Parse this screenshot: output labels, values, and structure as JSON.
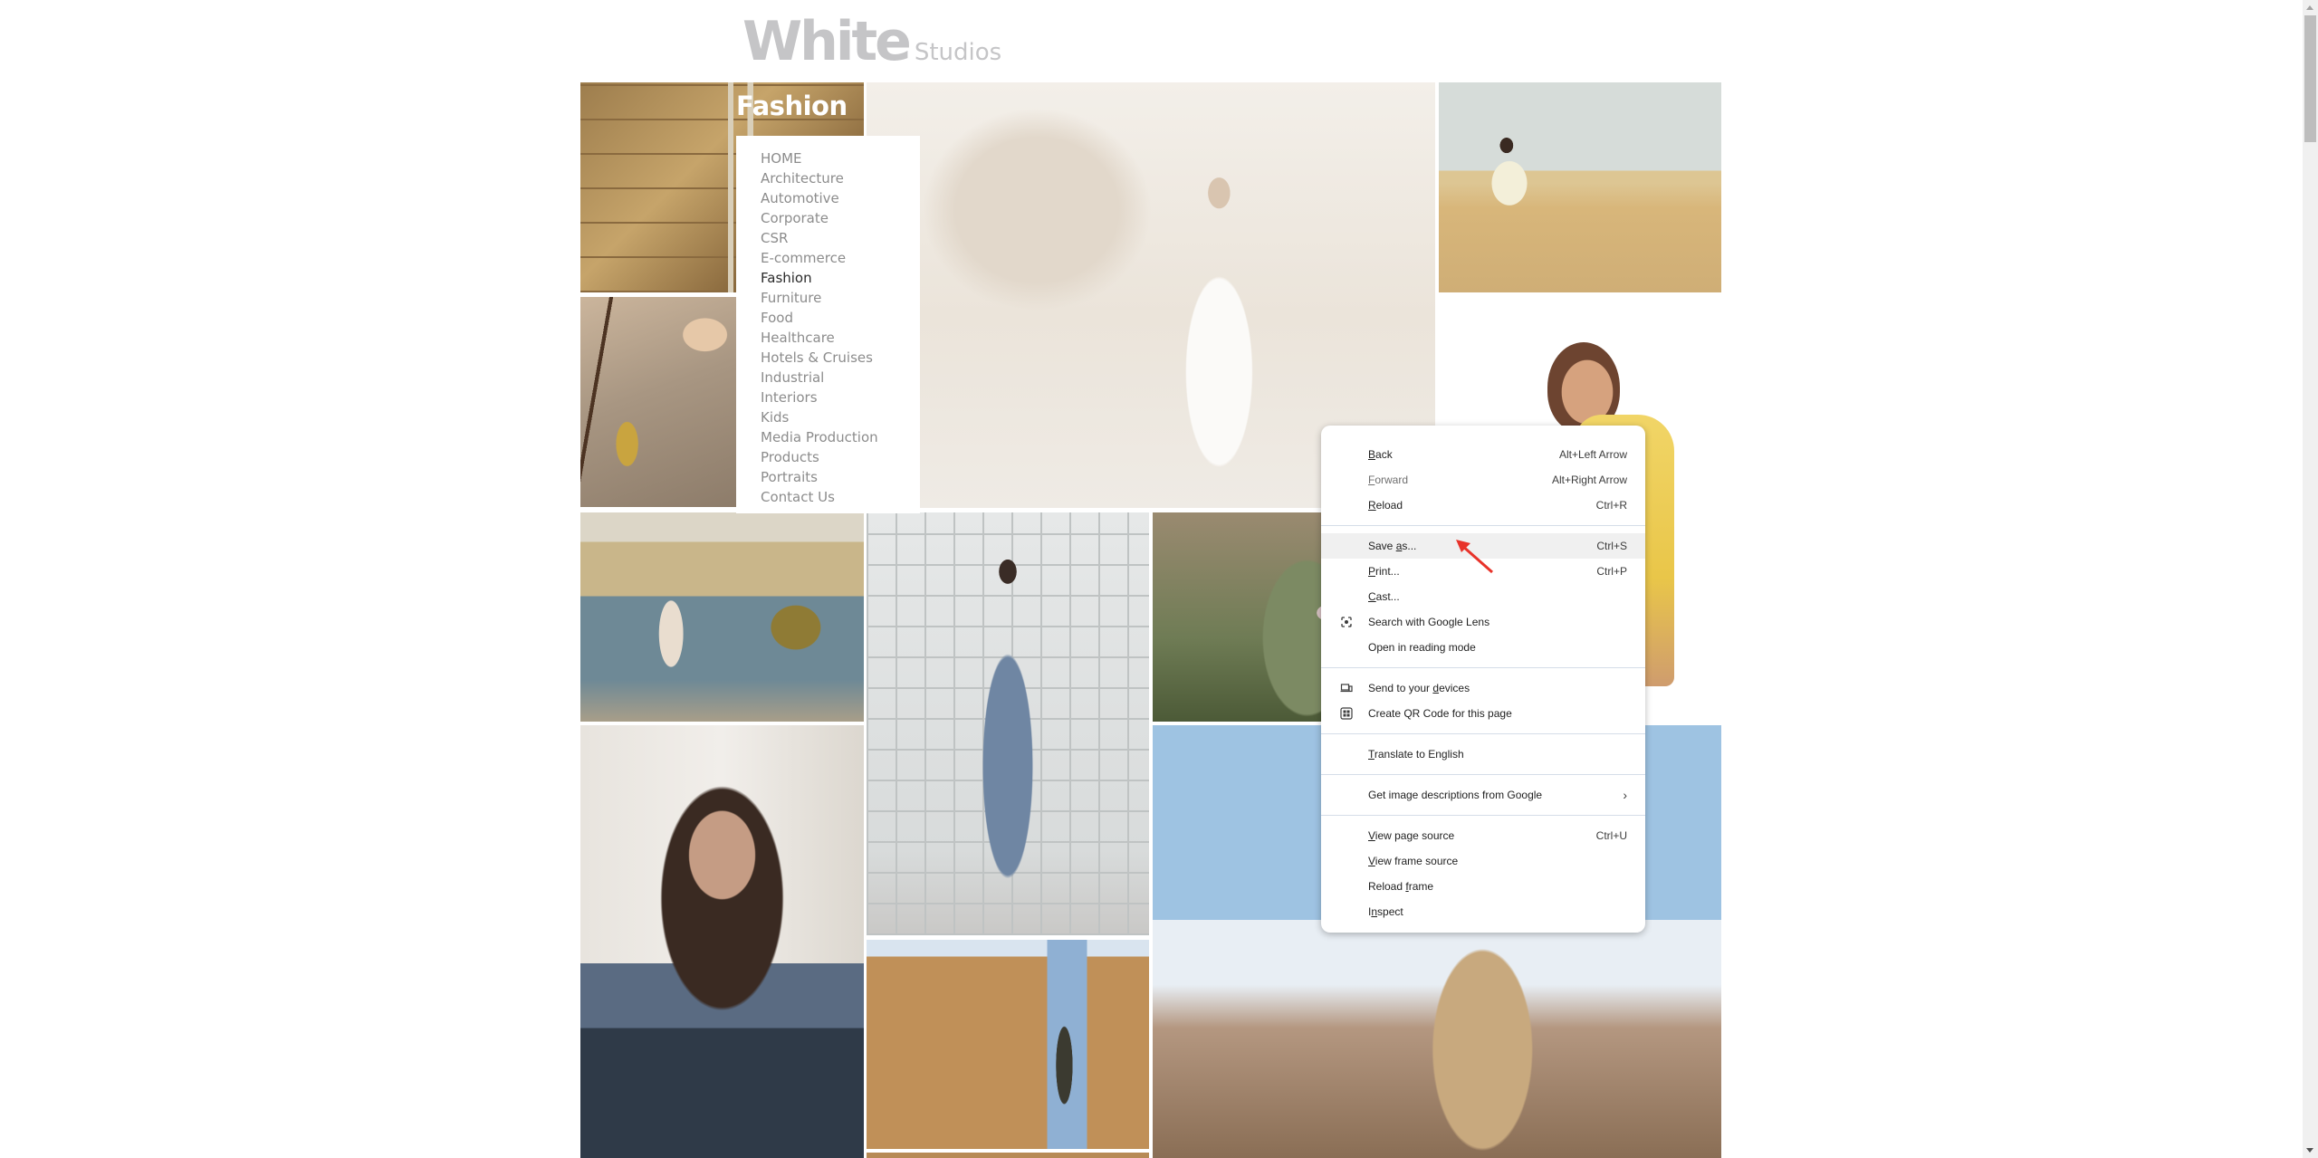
{
  "logo": {
    "main": "White",
    "sub": "Studios"
  },
  "page": {
    "heading": "Fashion"
  },
  "nav": {
    "items": [
      {
        "label": "HOME",
        "active": false
      },
      {
        "label": "Architecture",
        "active": false
      },
      {
        "label": "Automotive",
        "active": false
      },
      {
        "label": "Corporate",
        "active": false
      },
      {
        "label": "CSR",
        "active": false
      },
      {
        "label": "E-commerce",
        "active": false
      },
      {
        "label": "Fashion",
        "active": true
      },
      {
        "label": "Furniture",
        "active": false
      },
      {
        "label": "Food",
        "active": false
      },
      {
        "label": "Healthcare",
        "active": false
      },
      {
        "label": "Hotels & Cruises",
        "active": false
      },
      {
        "label": "Industrial",
        "active": false
      },
      {
        "label": "Interiors",
        "active": false
      },
      {
        "label": "Kids",
        "active": false
      },
      {
        "label": "Media Production",
        "active": false
      },
      {
        "label": "Products",
        "active": false
      },
      {
        "label": "Portraits",
        "active": false
      },
      {
        "label": "Contact Us",
        "active": false
      }
    ]
  },
  "gallery": {
    "tiles": [
      {
        "name": "woman-stone-wall-ladder"
      },
      {
        "name": "gold-necklace-closeup"
      },
      {
        "name": "woman-desert-cliff-faded"
      },
      {
        "name": "woman-sitting-desert-dune"
      },
      {
        "name": "woman-yellow-top"
      },
      {
        "name": "man-beach-lake"
      },
      {
        "name": "woman-blue-outfit-glass-wall"
      },
      {
        "name": "woman-green-embroidered-kimono"
      },
      {
        "name": "woman-portrait-lace-top"
      },
      {
        "name": "man-mud-wall-doorway"
      },
      {
        "name": "man-beige-jacket-sky"
      }
    ]
  },
  "context_menu": {
    "groups": [
      [
        {
          "pre": "",
          "u": "B",
          "post": "ack",
          "shortcut": "Alt+Left Arrow",
          "disabled": false,
          "icon": null
        },
        {
          "pre": "",
          "u": "F",
          "post": "orward",
          "shortcut": "Alt+Right Arrow",
          "disabled": true,
          "icon": null
        },
        {
          "pre": "",
          "u": "R",
          "post": "eload",
          "shortcut": "Ctrl+R",
          "disabled": false,
          "icon": null
        }
      ],
      [
        {
          "pre": "Save ",
          "u": "a",
          "post": "s...",
          "shortcut": "Ctrl+S",
          "disabled": false,
          "highlighted": true,
          "icon": null
        },
        {
          "pre": "",
          "u": "P",
          "post": "rint...",
          "shortcut": "Ctrl+P",
          "disabled": false,
          "icon": null
        },
        {
          "pre": "",
          "u": "C",
          "post": "ast...",
          "shortcut": "",
          "disabled": false,
          "icon": null
        },
        {
          "pre": "Search with Google Lens",
          "u": "",
          "post": "",
          "shortcut": "",
          "disabled": false,
          "icon": "google-lens-icon"
        },
        {
          "pre": "Open in reading mode",
          "u": "",
          "post": "",
          "shortcut": "",
          "disabled": false,
          "icon": null
        }
      ],
      [
        {
          "pre": "Send to your ",
          "u": "d",
          "post": "evices",
          "shortcut": "",
          "disabled": false,
          "icon": "devices-icon"
        },
        {
          "pre": "Create QR Code for this page",
          "u": "",
          "post": "",
          "shortcut": "",
          "disabled": false,
          "icon": "qr-code-icon"
        }
      ],
      [
        {
          "pre": "",
          "u": "T",
          "post": "ranslate to English",
          "shortcut": "",
          "disabled": false,
          "icon": null
        }
      ],
      [
        {
          "pre": "Get image descriptions from Google",
          "u": "",
          "post": "",
          "shortcut": "",
          "submenu": true,
          "submenu_glyph": "›",
          "disabled": false,
          "icon": null
        }
      ],
      [
        {
          "pre": "",
          "u": "V",
          "post": "iew page source",
          "shortcut": "Ctrl+U",
          "disabled": false,
          "icon": null
        },
        {
          "pre": "",
          "u": "V",
          "post": "iew frame source",
          "shortcut": "",
          "disabled": false,
          "icon": null
        },
        {
          "pre": "Reload ",
          "u": "f",
          "post": "rame",
          "shortcut": "",
          "disabled": false,
          "icon": null
        },
        {
          "pre": "I",
          "u": "n",
          "post": "spect",
          "shortcut": "",
          "disabled": false,
          "icon": null
        }
      ]
    ]
  },
  "annotation": {
    "arrow_color": "#e8332a",
    "points_to": "Save as..."
  },
  "colors": {
    "logo": "#c5c5c7",
    "nav_text": "#8c8c8c",
    "nav_active": "#2a2a2a",
    "menu_highlight": "#f0f0f0",
    "menu_separator": "#d5dde8"
  }
}
